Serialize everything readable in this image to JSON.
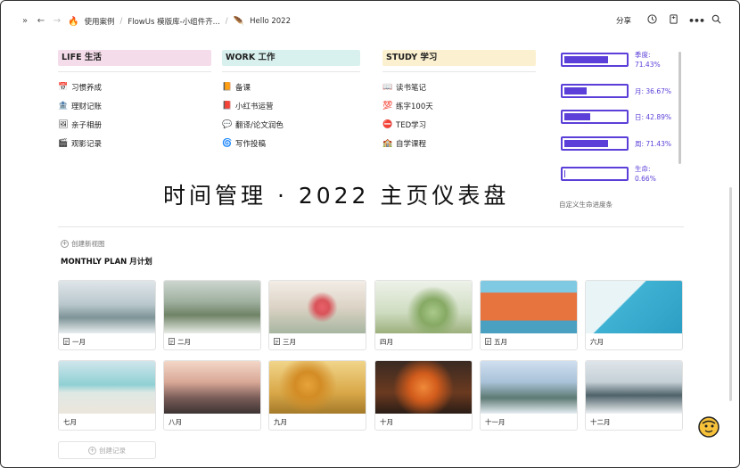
{
  "breadcrumb": {
    "items": [
      {
        "emoji": "🔥",
        "label": "使用案例"
      },
      {
        "emoji": "",
        "label": "FlowUs 模版库-小组件齐..."
      },
      {
        "emoji": "🪶",
        "label": "Hello 2022"
      }
    ]
  },
  "toolbar": {
    "share_label": "分享",
    "icons": [
      "clock-icon",
      "bookmark-icon",
      "more-icon",
      "search-icon"
    ]
  },
  "colors": {
    "life_bg": "#f5dcea",
    "work_bg": "#d9f1ee",
    "study_bg": "#fbf0d0",
    "progress": "#5b3fd8"
  },
  "categories": [
    {
      "title": "LIFE 生活",
      "items": [
        {
          "icon": "📅",
          "label": "习惯养成"
        },
        {
          "icon": "🏦",
          "label": "理财记账"
        },
        {
          "icon": "🖼",
          "label": "亲子相册"
        },
        {
          "icon": "🎬",
          "label": "观影记录"
        }
      ]
    },
    {
      "title": "WORK 工作",
      "items": [
        {
          "icon": "📙",
          "label": "备课"
        },
        {
          "icon": "📕",
          "label": "小红书运营"
        },
        {
          "icon": "💬",
          "label": "翻译/论文润色"
        },
        {
          "icon": "🌀",
          "label": "写作投稿"
        }
      ]
    },
    {
      "title": "STUDY 学习",
      "items": [
        {
          "icon": "📖",
          "label": "读书笔记"
        },
        {
          "icon": "💯",
          "label": "练字100天"
        },
        {
          "icon": "⛔",
          "label": "TED学习"
        },
        {
          "icon": "🏫",
          "label": "自学课程"
        }
      ]
    }
  ],
  "progress": {
    "items": [
      {
        "label": "季度:",
        "value_text": "71.43%",
        "fraction": 0.7143
      },
      {
        "label": "月: 36.67%",
        "value_text": "",
        "fraction": 0.3667
      },
      {
        "label": "日: 42.89%",
        "value_text": "",
        "fraction": 0.4289
      },
      {
        "label": "周: 71.43%",
        "value_text": "",
        "fraction": 0.7143
      },
      {
        "label": "生命:",
        "value_text": "0.66%",
        "fraction": 0.0066
      }
    ],
    "caption": "自定义生命进度条"
  },
  "page_title": "时间管理 · 2022 主页仪表盘",
  "new_view_label": "创建新视图",
  "monthly_title": "MONTHLY PLAN 月计划",
  "months": [
    {
      "label": "一月",
      "doc": true
    },
    {
      "label": "二月",
      "doc": true
    },
    {
      "label": "三月",
      "doc": true
    },
    {
      "label": "四月",
      "doc": false
    },
    {
      "label": "五月",
      "doc": true
    },
    {
      "label": "六月",
      "doc": false
    },
    {
      "label": "七月",
      "doc": false
    },
    {
      "label": "八月",
      "doc": false
    },
    {
      "label": "九月",
      "doc": false
    },
    {
      "label": "十月",
      "doc": false
    },
    {
      "label": "十一月",
      "doc": false
    },
    {
      "label": "十二月",
      "doc": false
    }
  ],
  "new_record_label": "创建记录"
}
